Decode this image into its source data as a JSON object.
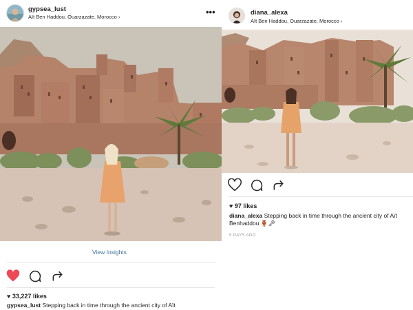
{
  "post_left": {
    "username": "gypsea_lust",
    "location": "Aït Ben Haddou, Ouarzazate, Morocco",
    "view_insights": "View Insights",
    "likes": "33,227 likes",
    "caption_user": "gypsea_lust",
    "caption_text": "Stepping back in time through the ancient city of Aït"
  },
  "post_right": {
    "username": "diana_alexa",
    "location": "Aït Ben Haddou, Ouarzazate, Morocco",
    "likes": "97 likes",
    "caption_user": "diana_alexa",
    "caption_text": "Stepping back in time through the ancient city of Aït Benhaddou 🏺🗝",
    "timestamp": "5 DAYS AGO"
  },
  "icons": {
    "chevron": "›",
    "more": "•••",
    "heart_liked_color": "#ed4956"
  }
}
